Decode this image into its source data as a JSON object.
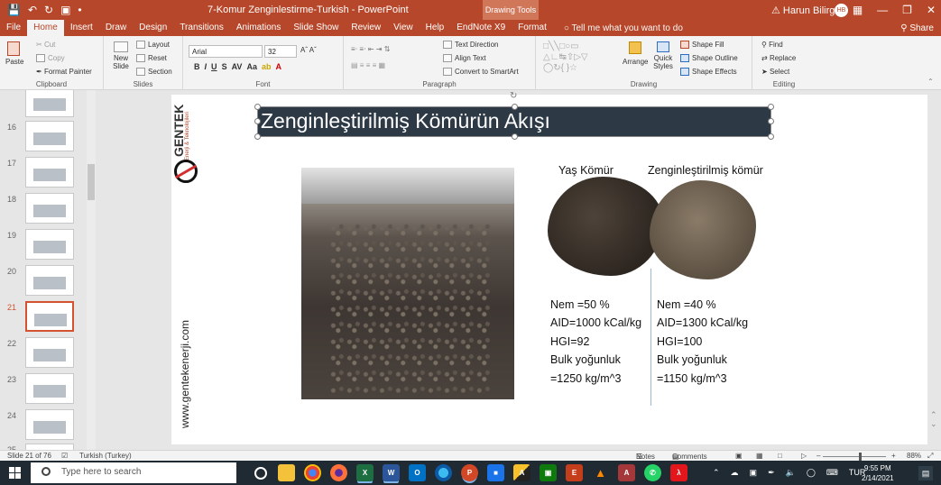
{
  "window": {
    "title": "7-Komur Zenginlestirme-Turkish  -  PowerPoint",
    "context_tab_group": "Drawing Tools",
    "user_name": "Harun Bilirgen",
    "user_initials": "HB",
    "qat": [
      "save",
      "undo",
      "redo",
      "present",
      "customize"
    ]
  },
  "tabs": [
    {
      "label": "File"
    },
    {
      "label": "Home"
    },
    {
      "label": "Insert"
    },
    {
      "label": "Draw"
    },
    {
      "label": "Design"
    },
    {
      "label": "Transitions"
    },
    {
      "label": "Animations"
    },
    {
      "label": "Slide Show"
    },
    {
      "label": "Review"
    },
    {
      "label": "View"
    },
    {
      "label": "Help"
    },
    {
      "label": "EndNote X9"
    },
    {
      "label": "Format"
    }
  ],
  "active_tab": "Home",
  "tell_me": "Tell me what you want to do",
  "share": "Share",
  "ribbon": {
    "clipboard": {
      "label": "Clipboard",
      "paste": "Paste",
      "cut": "Cut",
      "copy": "Copy",
      "format_painter": "Format Painter"
    },
    "slides": {
      "label": "Slides",
      "new_slide": "New Slide",
      "layout": "Layout",
      "reset": "Reset",
      "section": "Section"
    },
    "font": {
      "label": "Font",
      "family": "Arial",
      "size": "32"
    },
    "paragraph": {
      "label": "Paragraph",
      "text_direction": "Text Direction",
      "align_text": "Align Text",
      "convert_smartart": "Convert to SmartArt"
    },
    "drawing": {
      "label": "Drawing",
      "arrange": "Arrange",
      "quick_styles": "Quick Styles",
      "shape_fill": "Shape Fill",
      "shape_outline": "Shape Outline",
      "shape_effects": "Shape Effects"
    },
    "editing": {
      "label": "Editing",
      "find": "Find",
      "replace": "Replace",
      "select": "Select"
    }
  },
  "thumbnails": [
    {
      "num": "16"
    },
    {
      "num": "17"
    },
    {
      "num": "18"
    },
    {
      "num": "19"
    },
    {
      "num": "20"
    },
    {
      "num": "21",
      "selected": true
    },
    {
      "num": "22"
    },
    {
      "num": "23"
    },
    {
      "num": "24"
    },
    {
      "num": "25"
    }
  ],
  "slide": {
    "title": "Zenginleştirilmiş Kömürün Akışı",
    "brand": "GENTEK",
    "brand_sub": "Enerji & Teknolojileri",
    "website": "www.gentekenerji.com",
    "wet": {
      "heading": "Yaş Kömür",
      "lines": [
        "Nem =50 %",
        "AID=1000 kCal/kg",
        "HGI=92",
        "Bulk yoğunluk",
        "=1250 kg/m^3"
      ]
    },
    "dry": {
      "heading": "Zenginleştirilmiş kömür",
      "lines": [
        "Nem =40 %",
        "AID=1300 kCal/kg",
        "HGI=100",
        "Bulk yoğunluk",
        "=1150 kg/m^3"
      ]
    }
  },
  "status": {
    "slide_counter": "Slide 21 of 76",
    "language": "Turkish (Turkey)",
    "notes": "Notes",
    "comments": "Comments",
    "zoom": "88%"
  },
  "taskbar": {
    "search_placeholder": "Type here to search",
    "language": "TUR",
    "time": "9:55 PM",
    "date": "2/14/2021",
    "apps": [
      "task-view",
      "file-explorer",
      "chrome",
      "firefox",
      "excel",
      "word",
      "outlook",
      "edge",
      "powerpoint",
      "media",
      "acrobat-like",
      "onenote",
      "powerpoint-red",
      "vlc",
      "access",
      "whatsapp",
      "acrobat"
    ]
  },
  "colors": {
    "accent": "#b7472a",
    "title_box": "#2d3a46",
    "taskbar": "#1f2a33"
  }
}
